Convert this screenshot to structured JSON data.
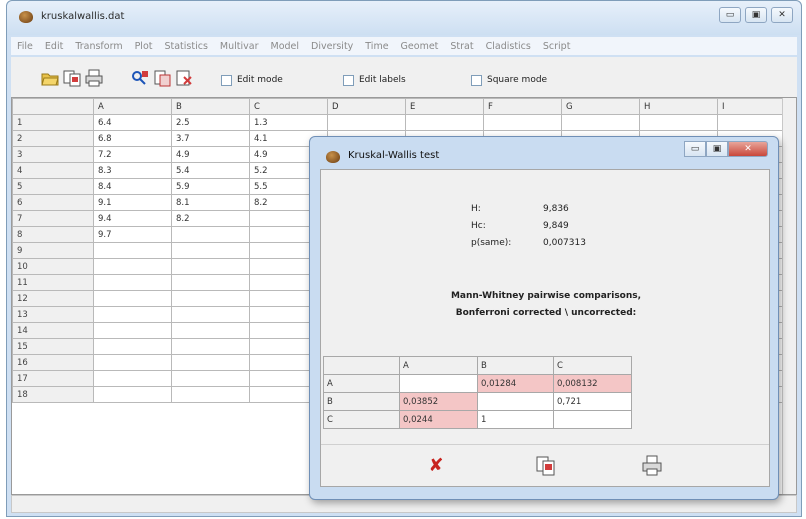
{
  "window": {
    "title": "kruskalwallis.dat",
    "controls": [
      "▭",
      "▣",
      "✕"
    ]
  },
  "menu": [
    "File",
    "Edit",
    "Transform",
    "Plot",
    "Statistics",
    "Multivar",
    "Model",
    "Diversity",
    "Time",
    "Geomet",
    "Strat",
    "Cladistics",
    "Script"
  ],
  "toolbar": {
    "checkboxes": [
      {
        "label": "Edit mode"
      },
      {
        "label": "Edit labels"
      },
      {
        "label": "Square mode"
      }
    ]
  },
  "spreadsheet": {
    "columns": [
      "A",
      "B",
      "C",
      "D",
      "E",
      "F",
      "G",
      "H",
      "I"
    ],
    "rows": [
      {
        "n": "1",
        "cells": [
          "6.4",
          "2.5",
          "1.3",
          "",
          "",
          "",
          "",
          "",
          ""
        ]
      },
      {
        "n": "2",
        "cells": [
          "6.8",
          "3.7",
          "4.1",
          "",
          "",
          "",
          "",
          "",
          ""
        ]
      },
      {
        "n": "3",
        "cells": [
          "7.2",
          "4.9",
          "4.9",
          "",
          "",
          "",
          "",
          "",
          ""
        ]
      },
      {
        "n": "4",
        "cells": [
          "8.3",
          "5.4",
          "5.2",
          "",
          "",
          "",
          "",
          "",
          ""
        ]
      },
      {
        "n": "5",
        "cells": [
          "8.4",
          "5.9",
          "5.5",
          "",
          "",
          "",
          "",
          "",
          ""
        ]
      },
      {
        "n": "6",
        "cells": [
          "9.1",
          "8.1",
          "8.2",
          "",
          "",
          "",
          "",
          "",
          ""
        ]
      },
      {
        "n": "7",
        "cells": [
          "9.4",
          "8.2",
          "",
          "",
          "",
          "",
          "",
          "",
          ""
        ]
      },
      {
        "n": "8",
        "cells": [
          "9.7",
          "",
          "",
          "",
          "",
          "",
          "",
          "",
          ""
        ]
      },
      {
        "n": "9",
        "cells": [
          "",
          "",
          "",
          "",
          "",
          "",
          "",
          "",
          ""
        ]
      },
      {
        "n": "10",
        "cells": [
          "",
          "",
          "",
          "",
          "",
          "",
          "",
          "",
          ""
        ]
      },
      {
        "n": "11",
        "cells": [
          "",
          "",
          "",
          "",
          "",
          "",
          "",
          "",
          ""
        ]
      },
      {
        "n": "12",
        "cells": [
          "",
          "",
          "",
          "",
          "",
          "",
          "",
          "",
          ""
        ]
      },
      {
        "n": "13",
        "cells": [
          "",
          "",
          "",
          "",
          "",
          "",
          "",
          "",
          ""
        ]
      },
      {
        "n": "14",
        "cells": [
          "",
          "",
          "",
          "",
          "",
          "",
          "",
          "",
          ""
        ]
      },
      {
        "n": "15",
        "cells": [
          "",
          "",
          "",
          "",
          "",
          "",
          "",
          "",
          ""
        ]
      },
      {
        "n": "16",
        "cells": [
          "",
          "",
          "",
          "",
          "",
          "",
          "",
          "",
          ""
        ]
      },
      {
        "n": "17",
        "cells": [
          "",
          "",
          "",
          "",
          "",
          "",
          "",
          "",
          ""
        ]
      },
      {
        "n": "18",
        "cells": [
          "",
          "",
          "",
          "",
          "",
          "",
          "",
          "",
          ""
        ]
      }
    ]
  },
  "dialog": {
    "title": "Kruskal-Wallis test",
    "stats": [
      {
        "label": "H:",
        "value": "9,836"
      },
      {
        "label": "Hc:",
        "value": "9,849"
      },
      {
        "label": "p(same):",
        "value": "0,007313"
      }
    ],
    "mw_heading_1": "Mann-Whitney pairwise comparisons,",
    "mw_heading_2": "Bonferroni corrected \\ uncorrected:",
    "mw_columns": [
      "",
      "A",
      "B",
      "C"
    ],
    "mw_rows": [
      {
        "label": "A",
        "cells": [
          "",
          "0,01284",
          "0,008132"
        ]
      },
      {
        "label": "B",
        "cells": [
          "0,03852",
          "",
          "0,721"
        ]
      },
      {
        "label": "C",
        "cells": [
          "0,0244",
          "1",
          ""
        ]
      }
    ],
    "highlight_color": "#f4c6c6"
  },
  "icons": {
    "close": "close-x-icon",
    "copy": "copy-icon",
    "print": "print-icon"
  }
}
